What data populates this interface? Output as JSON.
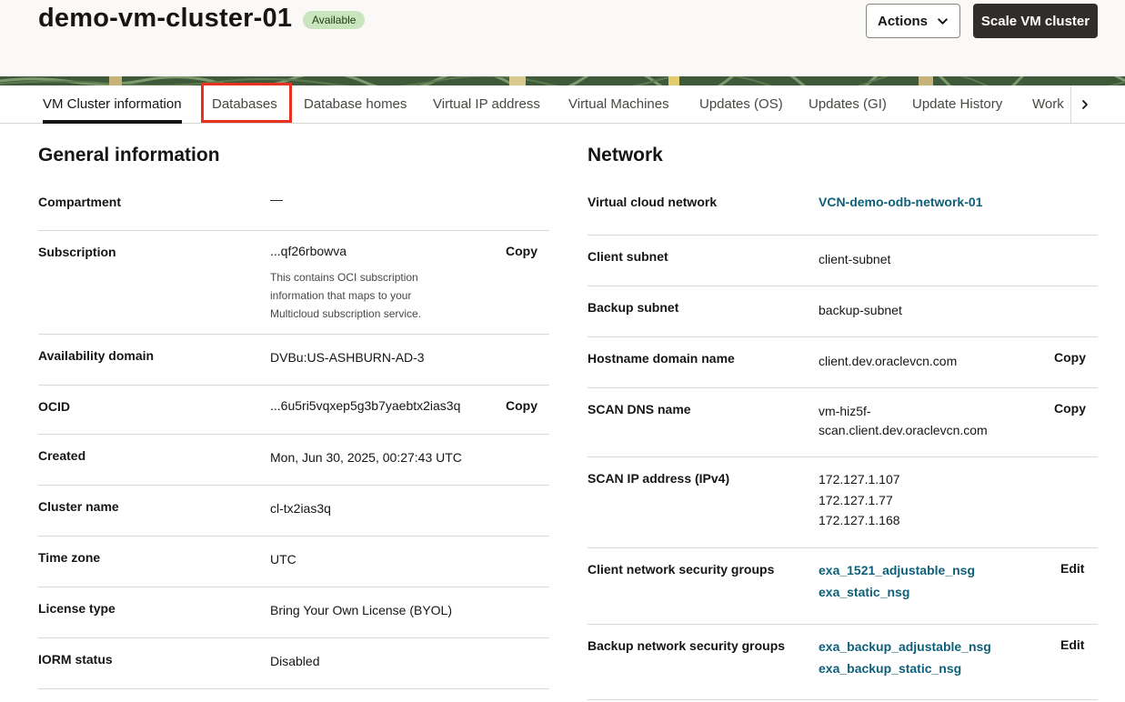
{
  "header": {
    "title": "demo-vm-cluster-01",
    "status": "Available",
    "actions_label": "Actions",
    "scale_label": "Scale VM cluster"
  },
  "tabs": [
    {
      "label": "VM Cluster information",
      "active": true
    },
    {
      "label": "Databases"
    },
    {
      "label": "Database homes"
    },
    {
      "label": "Virtual IP address"
    },
    {
      "label": "Virtual Machines"
    },
    {
      "label": "Updates (OS)"
    },
    {
      "label": "Updates (GI)"
    },
    {
      "label": "Update History"
    },
    {
      "label": "Work r"
    }
  ],
  "general": {
    "title": "General information",
    "copy_label": "Copy",
    "compartment": {
      "label": "Compartment",
      "value": "—"
    },
    "subscription": {
      "label": "Subscription",
      "value": "...qf26rbowva",
      "helper_1": "This contains OCI subscription",
      "helper_2": "information that maps to your",
      "helper_3": "Multicloud subscription service."
    },
    "availability_domain": {
      "label": "Availability domain",
      "value": "DVBu:US-ASHBURN-AD-3"
    },
    "ocid": {
      "label": "OCID",
      "value": "...6u5ri5vqxep5g3b7yaebtx2ias3q"
    },
    "created": {
      "label": "Created",
      "value": "Mon, Jun 30, 2025, 00:27:43 UTC"
    },
    "cluster_name": {
      "label": "Cluster name",
      "value": "cl-tx2ias3q"
    },
    "time_zone": {
      "label": "Time zone",
      "value": "UTC"
    },
    "license_type": {
      "label": "License type",
      "value": "Bring Your Own License (BYOL)"
    },
    "iorm_status": {
      "label": "IORM status",
      "value": "Disabled"
    }
  },
  "network": {
    "title": "Network",
    "copy_label": "Copy",
    "edit_label": "Edit",
    "vcn": {
      "label": "Virtual cloud network",
      "value": "VCN-demo-odb-network-01"
    },
    "client_subnet": {
      "label": "Client subnet",
      "value": "client-subnet"
    },
    "backup_subnet": {
      "label": "Backup subnet",
      "value": "backup-subnet"
    },
    "hostname_domain": {
      "label": "Hostname domain name",
      "value": "client.dev.oraclevcn.com"
    },
    "scan_dns": {
      "label": "SCAN DNS name",
      "value_1": "vm-hiz5f-",
      "value_2": "scan.client.dev.oraclevcn.com"
    },
    "scan_ip": {
      "label": "SCAN IP address (IPv4)",
      "ips": [
        "172.127.1.107",
        "172.127.1.77",
        "172.127.1.168"
      ]
    },
    "client_nsg": {
      "label": "Client network security groups",
      "items": [
        "exa_1521_adjustable_nsg",
        "exa_static_nsg"
      ]
    },
    "backup_nsg": {
      "label": "Backup network security groups",
      "items": [
        "exa_backup_adjustable_nsg",
        "exa_backup_static_nsg"
      ]
    }
  },
  "icons": {
    "actions": "chevron-down-icon",
    "tabs_next": "chevron-right-icon"
  },
  "colors": {
    "accent_link": "#0e5f7a",
    "badge_bg": "#c9e5c0",
    "primary_button": "#312d2a",
    "highlight": "#e8321f"
  }
}
